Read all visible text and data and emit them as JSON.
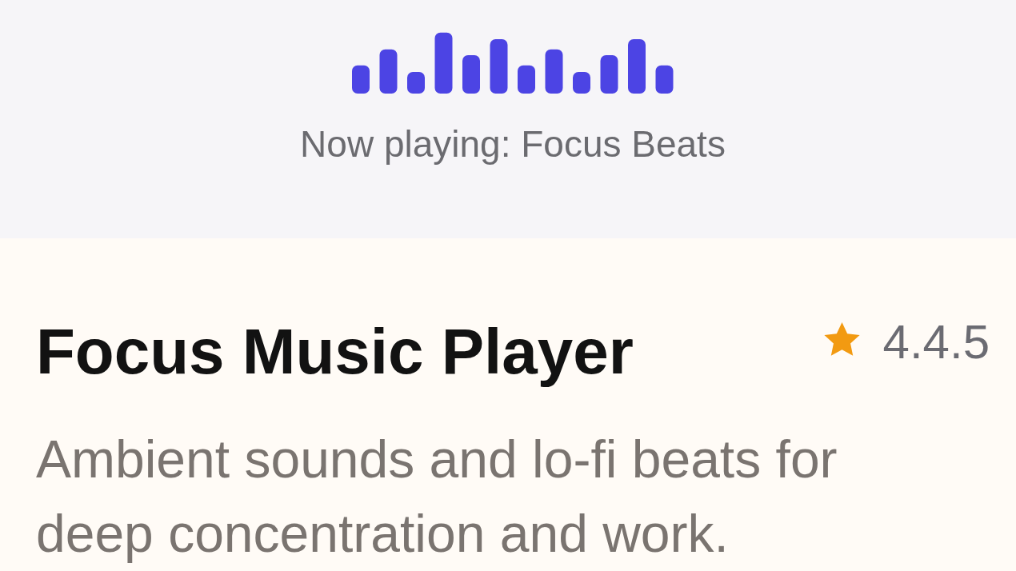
{
  "player": {
    "status": "Now playing: Focus Beats"
  },
  "app": {
    "title": "Focus Music Player",
    "rating": "4.4.5",
    "description": "Ambient sounds and lo-fi beats for deep concentration and work."
  }
}
